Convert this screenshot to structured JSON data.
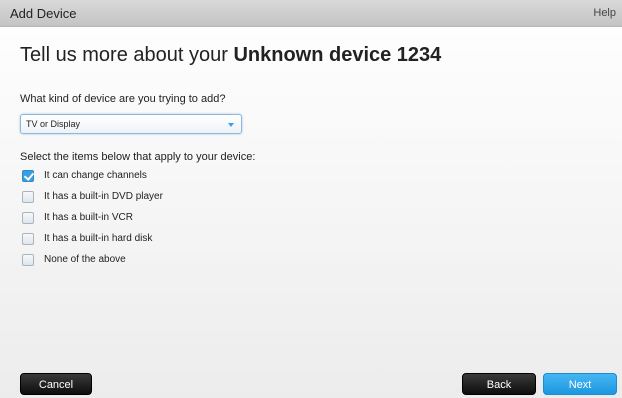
{
  "window": {
    "title": "Add Device",
    "help_label": "Help"
  },
  "heading": {
    "prefix": "Tell us more about your ",
    "device_name": "Unknown device 1234"
  },
  "device_type": {
    "question": "What kind of device are you trying to add?",
    "selected": "TV or Display"
  },
  "features": {
    "instruction": "Select the items below that apply to your device:",
    "options": [
      {
        "label": "It can change channels",
        "checked": true
      },
      {
        "label": "It has a built-in DVD player",
        "checked": false
      },
      {
        "label": "It has a built-in VCR",
        "checked": false
      },
      {
        "label": "It has a built-in hard disk",
        "checked": false
      },
      {
        "label": "None of the above",
        "checked": false
      }
    ]
  },
  "buttons": {
    "cancel": "Cancel",
    "back": "Back",
    "next": "Next"
  },
  "colors": {
    "accent": "#2aa3ea",
    "dark_button": "#111111",
    "titlebar": "#cfcfcf"
  }
}
